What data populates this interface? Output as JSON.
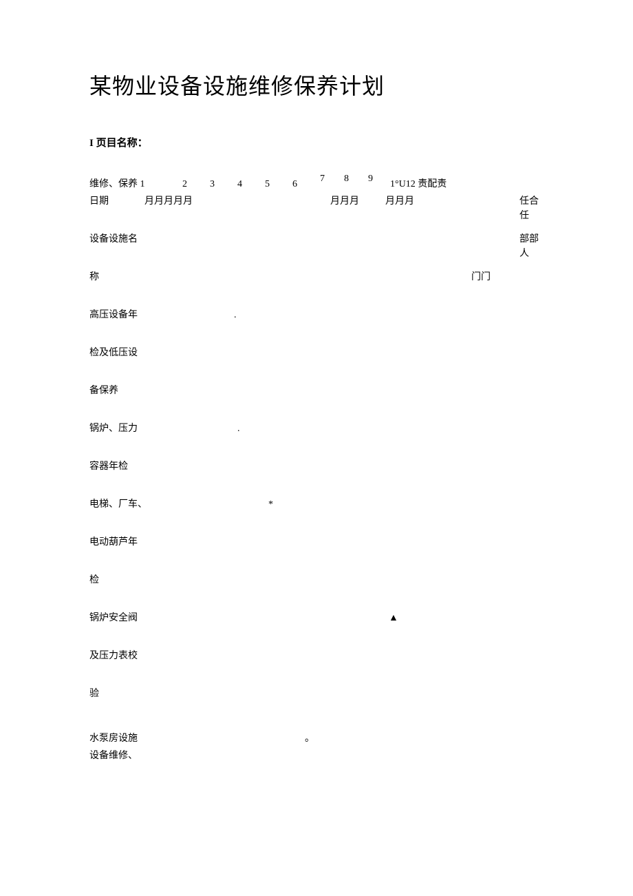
{
  "title": "某物业设备设施维修保养计划",
  "subtitle": "I 页目名称：",
  "header": {
    "col1": "维修、保养 1",
    "nums": [
      "2",
      "3",
      "4",
      "5",
      "6",
      "7",
      "8",
      "9"
    ],
    "rightText": "1°U12 责配责",
    "months1": "月月月月月",
    "months2": "月月月",
    "months3": "月月月",
    "dateLabel": "日期",
    "rightSuffix1": "任合任",
    "equipLabel": "设备设施名",
    "rightSuffix2": "部部人",
    "nameLabel": "称",
    "midRight": "门门"
  },
  "rows": [
    {
      "label": "高压设备年",
      "mark": ".",
      "markPos": 210
    },
    {
      "label": "检及低压设",
      "mark": "",
      "markPos": 0
    },
    {
      "label": "备保养",
      "mark": "",
      "markPos": 0
    },
    {
      "label": "锅炉、压力",
      "mark": ".",
      "markPos": 215
    },
    {
      "label": "容器年检",
      "mark": "",
      "markPos": 0
    },
    {
      "label": "电梯、厂车、",
      "mark": "*",
      "markPos": 260
    },
    {
      "label": "电动葫芦年",
      "mark": "",
      "markPos": 0
    },
    {
      "label": "检",
      "mark": "",
      "markPos": 0
    },
    {
      "label": "锅炉安全阀",
      "mark": "▲",
      "markPos": 435
    },
    {
      "label": "及压力表校",
      "mark": "",
      "markPos": 0
    },
    {
      "label": "验",
      "mark": "",
      "markPos": 0
    },
    {
      "label": "水泵房设施",
      "mark": "。",
      "markPos": 313
    }
  ],
  "lastRow": "设备维修、"
}
